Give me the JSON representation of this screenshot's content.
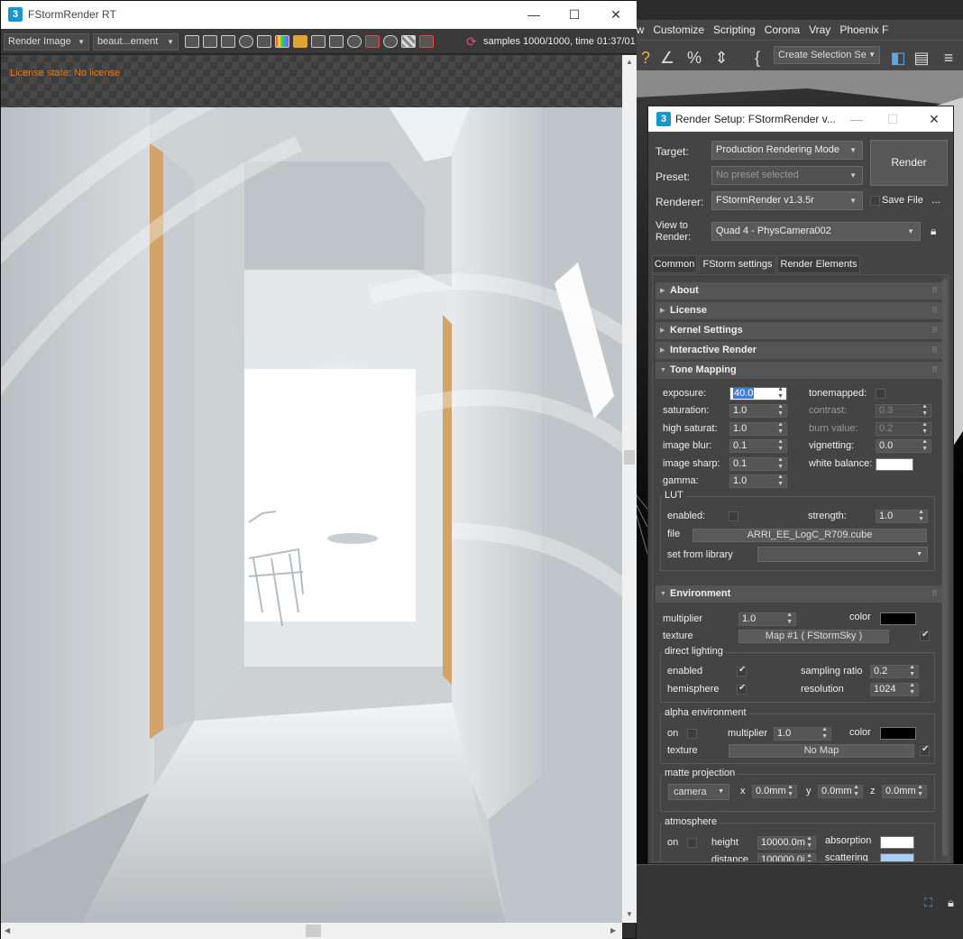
{
  "max": {
    "menu": [
      "ew",
      "Customize",
      "Scripting",
      "Corona",
      "Vray",
      "Phoenix F"
    ],
    "selection_set": "Create Selection Se"
  },
  "rt": {
    "title": "FStormRender RT",
    "app_icon": "3",
    "combo1": "Render Image",
    "combo2": "beaut...ement",
    "samples": "samples 1000/1000,  time 01:37/01",
    "license": "License state: No license"
  },
  "rs": {
    "title": "Render Setup: FStormRender v...",
    "app_icon": "3",
    "target_label": "Target:",
    "target_value": "Production Rendering Mode",
    "preset_label": "Preset:",
    "preset_value": "No preset selected",
    "renderer_label": "Renderer:",
    "renderer_value": "FStormRender v1.3.5r",
    "save_file": "Save File",
    "more": "...",
    "view_label": "View to Render:",
    "view_value": "Quad 4 - PhysCamera002",
    "render_button": "Render",
    "tabs": [
      "Common",
      "FStorm settings",
      "Render Elements"
    ],
    "rollouts": [
      "About",
      "License",
      "Kernel Settings",
      "Interactive Render",
      "Tone Mapping",
      "Environment"
    ],
    "tone": {
      "exposure_label": "exposure:",
      "exposure": "40.0",
      "saturation_label": "saturation:",
      "saturation": "1.0",
      "high_saturat_label": "high saturat:",
      "high_saturat": "1.0",
      "image_blur_label": "image blur:",
      "image_blur": "0.1",
      "image_sharp_label": "image sharp:",
      "image_sharp": "0.1",
      "gamma_label": "gamma:",
      "gamma": "1.0",
      "tonemapped_label": "tonemapped:",
      "contrast_label": "contrast:",
      "contrast": "0.3",
      "burn_label": "burn value:",
      "burn": "0.2",
      "vignetting_label": "vignetting:",
      "vignetting": "0.0",
      "wb_label": "white balance:",
      "wb_color": "#ffffff",
      "lut_title": "LUT",
      "lut_enabled_label": "enabled:",
      "lut_strength_label": "strength:",
      "lut_strength": "1.0",
      "lut_file_label": "file",
      "lut_file": "ARRI_EE_LogC_R709.cube",
      "lut_library_label": "set from library"
    },
    "env": {
      "multiplier_label": "multiplier",
      "multiplier": "1.0",
      "color_label": "color",
      "color": "#000000",
      "texture_label": "texture",
      "texture": "Map #1  ( FStormSky )",
      "direct_title": "direct lighting",
      "dl_enabled_label": "enabled",
      "dl_hemisphere_label": "hemisphere",
      "dl_sampling_label": "sampling ratio",
      "dl_sampling": "0.2",
      "dl_resolution_label": "resolution",
      "dl_resolution": "1024",
      "alpha_title": "alpha environment",
      "ae_on_label": "on",
      "ae_multiplier_label": "multiplier",
      "ae_multiplier": "1.0",
      "ae_color_label": "color",
      "ae_color": "#000000",
      "ae_texture_label": "texture",
      "ae_texture": "No Map",
      "matte_title": "matte projection",
      "matte_mode": "camera",
      "x_label": "x",
      "x": "0.0mm",
      "y_label": "y",
      "y": "0.0mm",
      "z_label": "z",
      "z": "0.0mm",
      "atm_title": "atmosphere",
      "atm_on_label": "on",
      "height_label": "height",
      "height": "10000.0m",
      "absorption_label": "absorption",
      "absorption_color": "#ffffff",
      "distance_label": "distance",
      "distance": "100000.0i",
      "scattering_label": "scattering",
      "scattering_color": "#a8cff0"
    }
  }
}
